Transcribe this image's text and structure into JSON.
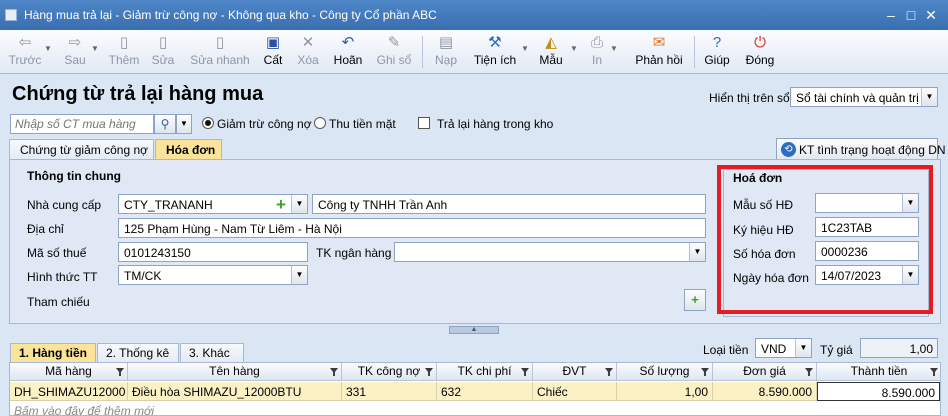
{
  "window": {
    "title": "Hàng mua trả lại - Giảm trừ công nợ - Không qua kho - Công ty Cổ phần ABC",
    "minimize": "–",
    "maximize": "□",
    "close": "✕"
  },
  "toolbar": {
    "back": "Trước",
    "next": "Sau",
    "add": "Thêm",
    "edit": "Sửa",
    "quick_edit": "Sửa nhanh",
    "save": "Cất",
    "delete": "Xóa",
    "cancel": "Hoãn",
    "post": "Ghi sổ",
    "load": "Nạp",
    "utilities": "Tiện ích",
    "template": "Mẫu",
    "print": "In",
    "feedback": "Phản hồi",
    "help": "Giúp",
    "close": "Đóng"
  },
  "header": {
    "page_title": "Chứng từ trả lại hàng mua",
    "display_label": "Hiển thị trên sổ",
    "display_value": "Sổ tài chính và quản trị",
    "search_placeholder": "Nhập số CT mua hàng",
    "option_reduce_debt": "Giảm trừ công nợ",
    "option_cash": "Thu tiền mặt",
    "option_return_in_stock": "Trả lại hàng trong kho"
  },
  "tabs": {
    "debt_voucher": "Chứng từ giảm công nợ",
    "invoice": "Hóa đơn"
  },
  "kt_button": "KT tình trạng hoạt động DN",
  "general_info": {
    "title": "Thông tin chung",
    "supplier_label": "Nhà cung cấp",
    "supplier_code": "CTY_TRANANH",
    "supplier_name": "Công ty TNHH Trần Anh",
    "address_label": "Địa chỉ",
    "address": "125 Phạm Hùng - Nam Từ Liêm - Hà Nội",
    "tax_code_label": "Mã số thuế",
    "tax_code": "0101243150",
    "bank_account_label": "TK ngân hàng",
    "bank_account": "",
    "payment_method_label": "Hình thức TT",
    "payment_method": "TM/CK",
    "reference_label": "Tham chiếu"
  },
  "invoice": {
    "title": "Hoá đơn",
    "form_label": "Mẫu số HĐ",
    "form_value": "",
    "symbol_label": "Ký hiệu HĐ",
    "symbol_value": "1C23TAB",
    "number_label": "Số hóa đơn",
    "number_value": "0000236",
    "date_label": "Ngày hóa đơn",
    "date_value": "14/07/2023"
  },
  "bottom_tabs": {
    "money": "1. Hàng tiền",
    "stats": "2. Thống kê",
    "other": "3. Khác"
  },
  "currency": {
    "label": "Loại tiền",
    "value": "VND",
    "rate_label": "Tỷ giá",
    "rate_value": "1,00"
  },
  "grid": {
    "columns": [
      "Mã hàng",
      "Tên hàng",
      "TK công nợ",
      "TK chi phí",
      "ĐVT",
      "Số lượng",
      "Đơn giá",
      "Thành tiền"
    ],
    "rows": [
      [
        "DH_SHIMAZU12000",
        "Điều hòa SHIMAZU_12000BTU",
        "331",
        "632",
        "Chiếc",
        "1,00",
        "8.590.000",
        "8.590.000"
      ]
    ],
    "hint": "Bấm vào đây để thêm mới"
  }
}
